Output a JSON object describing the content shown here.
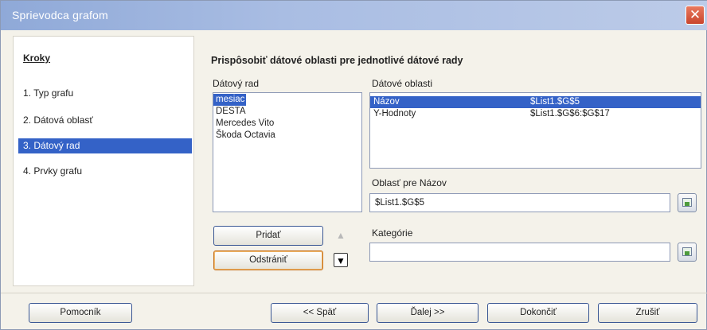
{
  "window": {
    "title": "Sprievodca grafom"
  },
  "steps": {
    "heading": "Kroky",
    "items": [
      {
        "label": "1. Typ grafu"
      },
      {
        "label": "2. Dátová oblasť"
      },
      {
        "label": "3. Dátový rad"
      },
      {
        "label": "4. Prvky grafu"
      }
    ],
    "active_index": 2
  },
  "main": {
    "heading": "Prispôsobiť dátové oblasti pre jednotlivé dátové rady",
    "series_label": "Dátový rad",
    "series": [
      "mesiac",
      "DESTA",
      "Mercedes Vito",
      "Škoda Octavia"
    ],
    "selected_series": "mesiac",
    "ranges_label": "Dátové oblasti",
    "ranges": [
      {
        "name": "Názov",
        "range": "$List1.$G$5"
      },
      {
        "name": "Y-Hodnoty",
        "range": "$List1.$G$6:$G$17"
      }
    ],
    "name_range_label": "Oblasť pre Názov",
    "name_range_value": "$List1.$G$5",
    "categories_label": "Kategórie",
    "categories_value": "",
    "add_button": "Pridať",
    "remove_button": "Odstrániť"
  },
  "footer": {
    "help": "Pomocník",
    "back": "<< Späť",
    "next": "Ďalej >>",
    "finish": "Dokončiť",
    "cancel": "Zrušiť"
  }
}
